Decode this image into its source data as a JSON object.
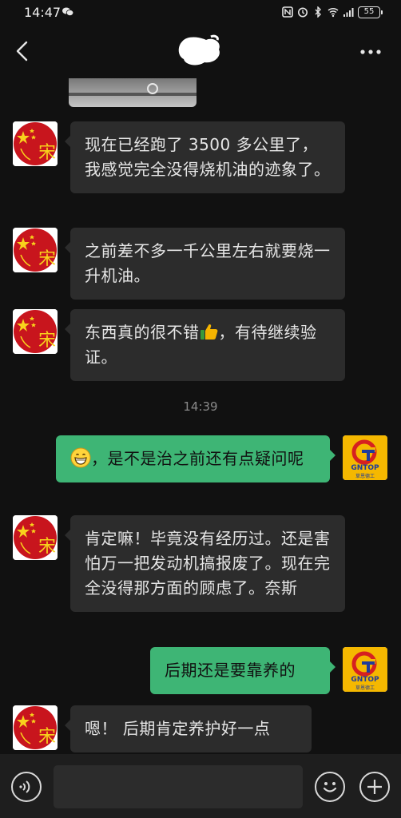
{
  "status_bar": {
    "time": "14:47",
    "battery": "55",
    "network": "4G"
  },
  "header": {
    "back_icon": "chevron-left-icon",
    "title_icon": "redacted-name",
    "more_icon": "more-dots-icon"
  },
  "colors": {
    "incoming_bubble": "#2c2c2c",
    "outgoing_bubble": "#3eb575",
    "background": "#111111",
    "contact_avatar_red": "#c8151d",
    "self_avatar_yellow": "#f5b800"
  },
  "contact_avatar": {
    "text": "宋"
  },
  "self_avatar": {
    "brand": "GNTOP",
    "subtitle": "草恩德工"
  },
  "messages": [
    {
      "from": "contact",
      "text": "现在已经跑了 3500 多公里了，我感觉完全没得烧机油的迹象了。"
    },
    {
      "from": "contact",
      "text": "之前差不多一千公里左右就要烧一升机油。"
    },
    {
      "from": "contact",
      "text_before": "东西真的很不错",
      "emoji": "thumbs-up-icon",
      "text_after": "，有待继续验证。"
    },
    {
      "from": "self",
      "emoji": "grinning-face-icon",
      "text": "，是不是治之前还有点疑问呢"
    },
    {
      "from": "contact",
      "text": "肯定嘛！毕竟没有经历过。还是害怕万一把发动机搞报废了。现在完全没得那方面的顾虑了。奈斯"
    },
    {
      "from": "self",
      "text": "后期还是要靠养的"
    },
    {
      "from": "contact",
      "text": "嗯！ 后期肯定养护好一点"
    }
  ],
  "timestamp": "14:39",
  "input_bar": {
    "voice_icon": "voice-icon",
    "input_value": "",
    "emoji_icon": "emoji-icon",
    "plus_icon": "plus-icon"
  }
}
